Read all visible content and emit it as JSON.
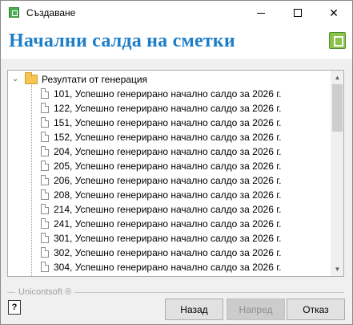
{
  "window": {
    "title": "Създаване"
  },
  "titlebar": {
    "minimize_glyph": "",
    "close_glyph": "✕"
  },
  "header": {
    "title": "Начални салда на сметки"
  },
  "tree": {
    "root_label": "Резултати от генерация",
    "expander_glyph": "⌄",
    "items": [
      "101, Успешно генерирано начално салдо за 2026 г.",
      "122, Успешно генерирано начално салдо за 2026 г.",
      "151, Успешно генерирано начално салдо за 2026 г.",
      "152, Успешно генерирано начално салдо за 2026 г.",
      "204, Успешно генерирано начално салдо за 2026 г.",
      "205, Успешно генерирано начално салдо за 2026 г.",
      "206, Успешно генерирано начално салдо за 2026 г.",
      "208, Успешно генерирано начално салдо за 2026 г.",
      "214, Успешно генерирано начално салдо за 2026 г.",
      "241, Успешно генерирано начално салдо за 2026 г.",
      "301, Успешно генерирано начално салдо за 2026 г.",
      "302, Успешно генерирано начално салдо за 2026 г.",
      "304, Успешно генерирано начално салдо за 2026 г."
    ]
  },
  "scrollbar": {
    "up_glyph": "▲",
    "down_glyph": "▼"
  },
  "footer": {
    "brand": "Unicontsoft ®",
    "help_glyph": "?",
    "back_label": "Назад",
    "next_label": "Напред",
    "cancel_label": "Отказ"
  }
}
